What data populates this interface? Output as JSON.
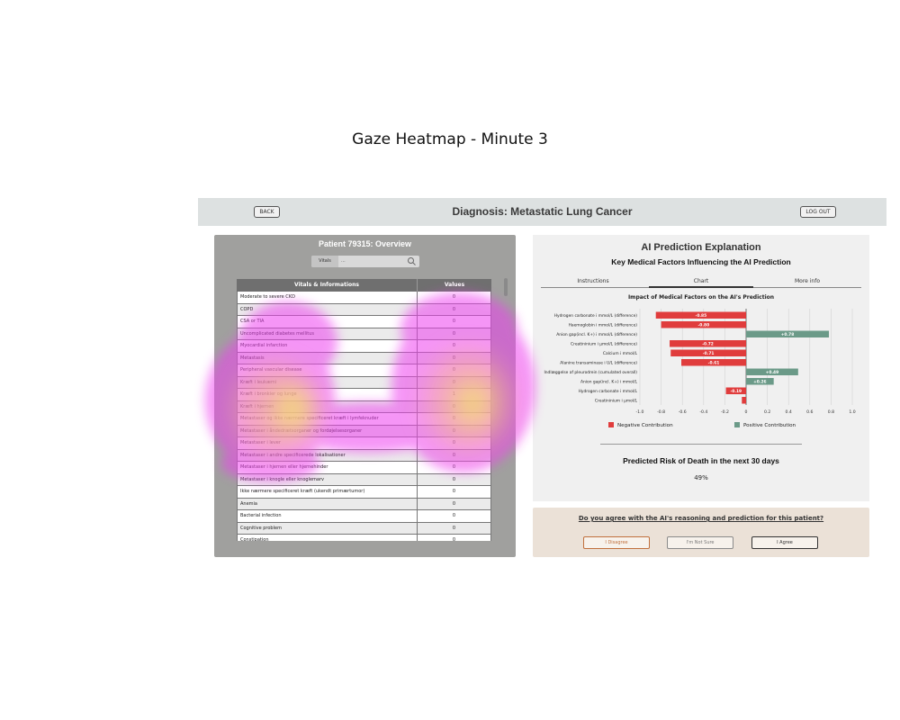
{
  "figure": {
    "title": "Gaze Heatmap - Minute 3"
  },
  "header": {
    "back_label": "BACK",
    "title": "Diagnosis: Metastatic Lung Cancer",
    "logout_label": "LOG OUT"
  },
  "overview": {
    "title": "Patient 79315: Overview",
    "search": {
      "label": "Vitals",
      "placeholder": "...",
      "icon": "search-icon"
    },
    "table": {
      "headers": [
        "Vitals & Informations",
        "Values"
      ],
      "rows": [
        [
          "Moderate to severe CKD",
          "0"
        ],
        [
          "COPD",
          "0"
        ],
        [
          "CSA or TIA",
          "0"
        ],
        [
          "Uncomplicated diabetes mellitus",
          "0"
        ],
        [
          "Myocardial infarction",
          "0"
        ],
        [
          "Metastasis",
          "0"
        ],
        [
          "Peripheral vascular disease",
          "0"
        ],
        [
          "Kræft i leukæmi",
          "0"
        ],
        [
          "Kræft i bronkier og lunge",
          "1"
        ],
        [
          "Kræft i hjernen",
          "0"
        ],
        [
          "Metastaser og ikke nærmere specificeret kræft i lymfeknuder",
          "0"
        ],
        [
          "Metastaser i åndedrætsorganer og fordøjelsesorganer",
          "0"
        ],
        [
          "Metastaser i lever",
          "0"
        ],
        [
          "Metastaser i andre specificerede lokalisationer",
          "0"
        ],
        [
          "Metastaser i hjernen eller hjernehinder",
          "0"
        ],
        [
          "Metastaser i knogle eller knoglemarv",
          "0"
        ],
        [
          "Ikke nærmere specificeret kræft (ukendt primærtumor)",
          "0"
        ],
        [
          "Anemia",
          "0"
        ],
        [
          "Bacterial infection",
          "0"
        ],
        [
          "Cognitive problem",
          "0"
        ],
        [
          "Constipation",
          "0"
        ]
      ]
    }
  },
  "ai_panel": {
    "title": "AI Prediction Explanation",
    "subtitle": "Key Medical Factors Influencing the AI Prediction",
    "tabs": [
      "Instructions",
      "Chart",
      "More info"
    ],
    "active_tab": "Chart",
    "divider_color": "#999999",
    "risk_label": "Predicted Risk of Death in the next 30 days",
    "risk_value": "49%"
  },
  "chart_data": {
    "type": "bar",
    "orientation": "horizontal",
    "title": "Impact of Medical Factors on the AI's Prediction",
    "categories": [
      "Hydrogen carbonate i mmol/L (difference)",
      "Haemoglobin i mmol/L (difference)",
      "Anion gap(incl. K+) i mmol/L (difference)",
      "Creatininium i μmol/L (difference)",
      "Calcium i mmol/L",
      "Alanine transaminase i U/L (difference)",
      "Indlæggelse af pleurodrein (cumulated overall)",
      "Anion gap(incl. K+) i mmol/L",
      "Hydrogen carbonate i mmol/L",
      "Creatininium i μmol/L"
    ],
    "values": [
      -0.85,
      -0.8,
      0.78,
      -0.72,
      -0.71,
      -0.61,
      0.49,
      0.26,
      -0.19,
      -0.04
    ],
    "value_labels": [
      "-0.85",
      "-0.80",
      "+0.78",
      "-0.72",
      "-0.71",
      "-0.61",
      "+0.49",
      "+0.26",
      "-0.19",
      ""
    ],
    "xlim": [
      -1.0,
      1.0
    ],
    "xticks": [
      "-1.0",
      "-0.8",
      "-0.6",
      "-0.4",
      "-0.2",
      "0",
      "0.2",
      "0.4",
      "0.6",
      "0.8",
      "1.0"
    ],
    "grid": true,
    "legend": [
      {
        "label": "Negative Contribution",
        "color": "#e03c3c"
      },
      {
        "label": "Positive Contribution",
        "color": "#6b9a88"
      }
    ],
    "negative_color": "#e03c3c",
    "positive_color": "#6b9a88"
  },
  "agreement": {
    "question": "Do you agree with the AI's reasoning and prediction for this patient?",
    "buttons": {
      "disagree": "I Disagree",
      "not_sure": "I'm Not Sure",
      "agree": "I Agree"
    }
  },
  "heatmap": {
    "colors": [
      "#ee3ff0",
      "#f07ad0",
      "#f3b78c",
      "#f5ee60"
    ]
  }
}
